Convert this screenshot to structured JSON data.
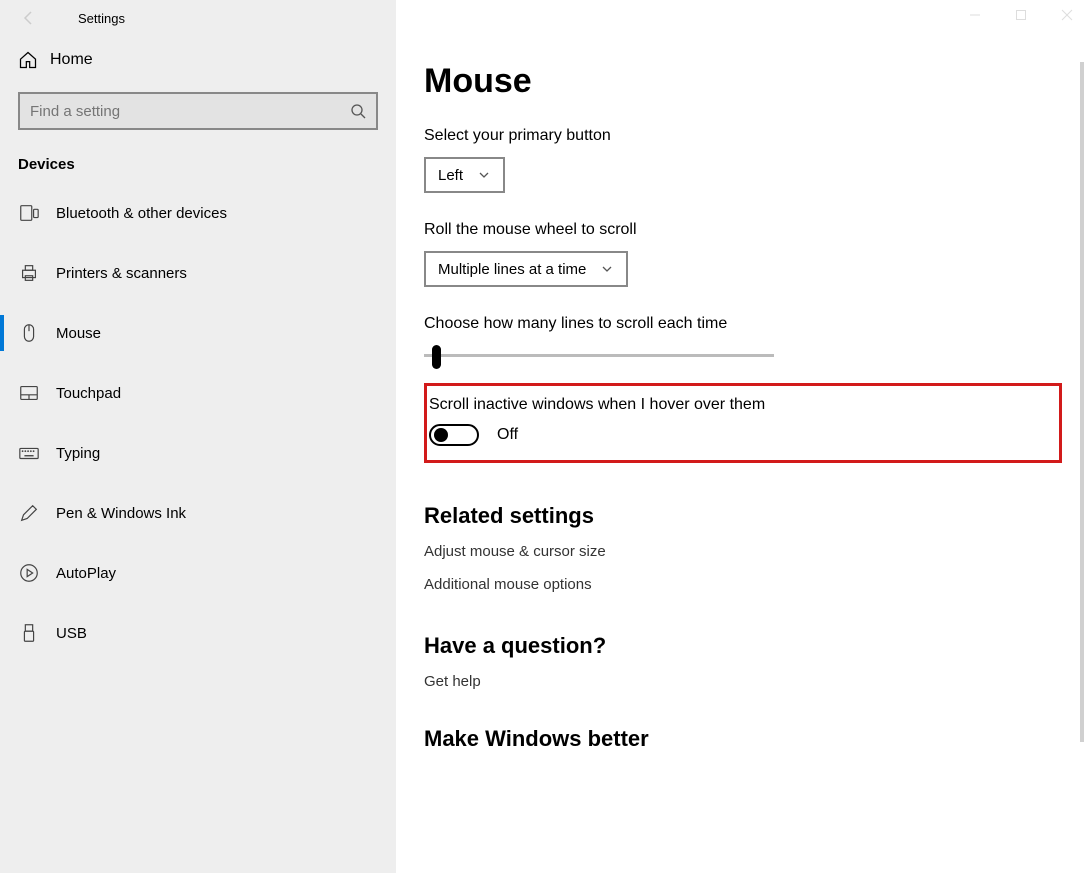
{
  "window": {
    "title": "Settings"
  },
  "sidebar": {
    "home": "Home",
    "search_placeholder": "Find a setting",
    "section": "Devices",
    "items": [
      {
        "label": "Bluetooth & other devices"
      },
      {
        "label": "Printers & scanners"
      },
      {
        "label": "Mouse"
      },
      {
        "label": "Touchpad"
      },
      {
        "label": "Typing"
      },
      {
        "label": "Pen & Windows Ink"
      },
      {
        "label": "AutoPlay"
      },
      {
        "label": "USB"
      }
    ]
  },
  "main": {
    "title": "Mouse",
    "primary_button_label": "Select your primary button",
    "primary_button_value": "Left",
    "scroll_wheel_label": "Roll the mouse wheel to scroll",
    "scroll_wheel_value": "Multiple lines at a time",
    "lines_label": "Choose how many lines to scroll each time",
    "inactive_label": "Scroll inactive windows when I hover over them",
    "inactive_value": "Off",
    "related_heading": "Related settings",
    "related_links": [
      "Adjust mouse & cursor size",
      "Additional mouse options"
    ],
    "question_heading": "Have a question?",
    "question_link": "Get help",
    "feedback_heading": "Make Windows better"
  }
}
